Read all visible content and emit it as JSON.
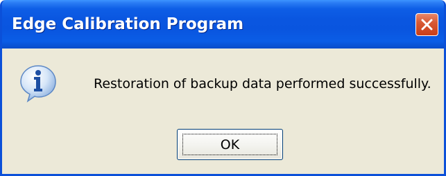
{
  "dialog": {
    "title": "Edge Calibration Program",
    "message": "Restoration of backup data performed successfully.",
    "icon": "info-icon",
    "close_icon": "close-icon",
    "ok_label": "OK"
  },
  "colors": {
    "titlebar": "#0a56e0",
    "frame": "#0b50d9",
    "body": "#ece9d8",
    "close_button": "#d85a35",
    "info_icon": "#3a7bd5"
  }
}
